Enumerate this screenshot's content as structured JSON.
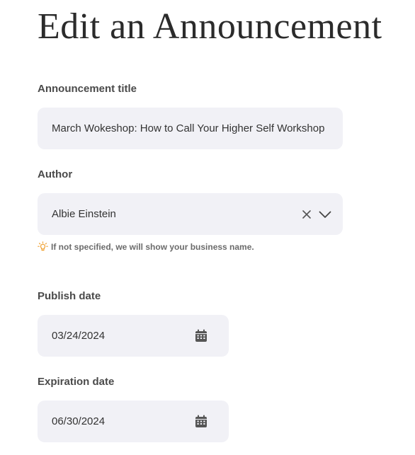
{
  "page": {
    "title": "Edit an Announcement"
  },
  "form": {
    "title_field": {
      "label": "Announcement title",
      "value": "March Wokeshop: How to Call Your Higher Self Workshop"
    },
    "author_field": {
      "label": "Author",
      "value": "Albie Einstein",
      "clear_icon": "close-icon",
      "dropdown_icon": "chevron-down-icon",
      "hint_icon": "lightbulb-icon",
      "hint": "If not specified, we will show your business name."
    },
    "publish_date": {
      "label": "Publish date",
      "value": "03/24/2024",
      "icon": "calendar-icon"
    },
    "expiration_date": {
      "label": "Expiration date",
      "value": "06/30/2024",
      "icon": "calendar-icon"
    }
  },
  "colors": {
    "field_background": "#f1f1f6",
    "hint_icon": "#f0a030",
    "icon_gray": "#555555"
  }
}
